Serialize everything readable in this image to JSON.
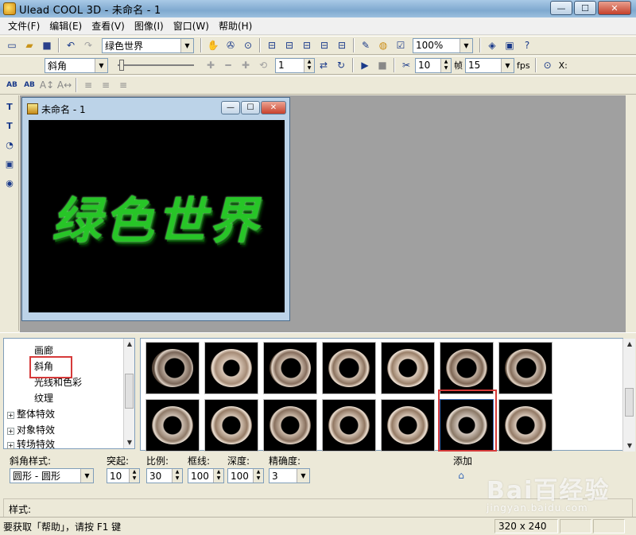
{
  "window": {
    "title": "Ulead COOL 3D - 未命名 - 1",
    "minimize": "—",
    "maximize": "☐",
    "close": "✕"
  },
  "menu": [
    {
      "label": "文件(F)"
    },
    {
      "label": "编辑(E)"
    },
    {
      "label": "查看(V)"
    },
    {
      "label": "图像(I)"
    },
    {
      "label": "窗口(W)"
    },
    {
      "label": "帮助(H)"
    }
  ],
  "toolbar1": {
    "text_combo": "绿色世界",
    "zoom_combo": "100%"
  },
  "toolbar2": {
    "effect_combo": "斜角",
    "frame_value": "1",
    "rate_value": "10",
    "frame_label": "帧",
    "fps_value": "15",
    "fps_label": "fps",
    "xy_label": "X:"
  },
  "toolbar3": {
    "ab1": "AB",
    "ab2": "AB"
  },
  "doc_window": {
    "title": "未命名 - 1",
    "canvas_text": "绿色世界"
  },
  "tree": {
    "items": [
      {
        "label": "画廊",
        "indent": "leaf"
      },
      {
        "label": "斜角",
        "indent": "leaf"
      },
      {
        "label": "光线和色彩",
        "indent": "leaf"
      },
      {
        "label": "纹理",
        "indent": "leaf"
      },
      {
        "label": "整体特效",
        "indent": "node"
      },
      {
        "label": "对象特效",
        "indent": "node"
      },
      {
        "label": "转场特效",
        "indent": "node"
      }
    ]
  },
  "params": {
    "bevel_style_label": "斜角样式:",
    "bevel_style_value": "圆形 - 圆形",
    "bulge_label": "突起:",
    "bulge_value": "10",
    "ratio_label": "比例:",
    "ratio_value": "30",
    "border_label": "框线:",
    "border_value": "100",
    "depth_label": "深度:",
    "depth_value": "100",
    "precision_label": "精确度:",
    "precision_value": "3",
    "add_label": "添加"
  },
  "style_label": "样式:",
  "status": {
    "help_text": "要获取「帮助」，请按 F1 键",
    "canvas_size": "320 x 240"
  },
  "watermark": {
    "brand": "Bai百经验",
    "sub": "jingyan.baidu.com"
  },
  "colors": {
    "canvas_text": "#27c527",
    "highlight": "#d63a3a"
  }
}
